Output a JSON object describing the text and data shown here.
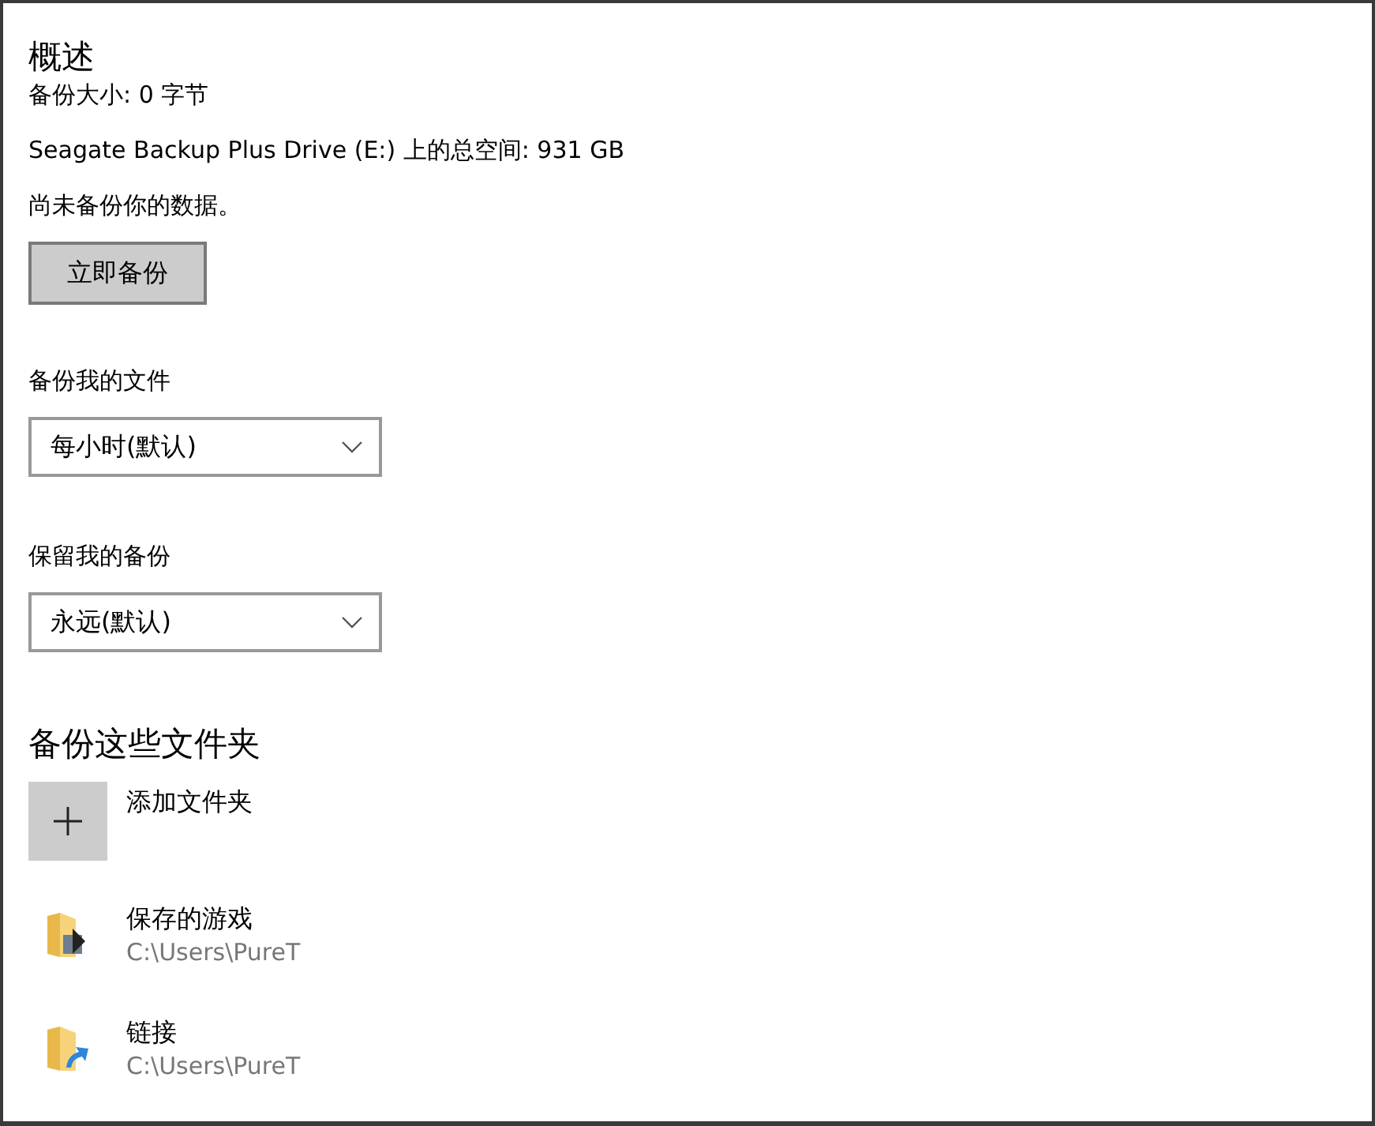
{
  "overview": {
    "title": "概述",
    "lines": [
      "备份大小: 0 字节",
      "Seagate Backup Plus Drive (E:) 上的总空间: 931 GB",
      "尚未备份你的数据。"
    ],
    "button": "立即备份"
  },
  "settings": [
    {
      "label": "备份我的文件",
      "value": "每小时(默认)"
    },
    {
      "label": "保留我的备份",
      "value": "永远(默认)"
    }
  ],
  "folders": {
    "title": "备份这些文件夹",
    "add_label": "添加文件夹",
    "items": [
      {
        "kind": "games",
        "name": "保存的游戏",
        "path": "C:\\Users\\PureT"
      },
      {
        "kind": "link",
        "name": "链接",
        "path": "C:\\Users\\PureT"
      }
    ]
  }
}
